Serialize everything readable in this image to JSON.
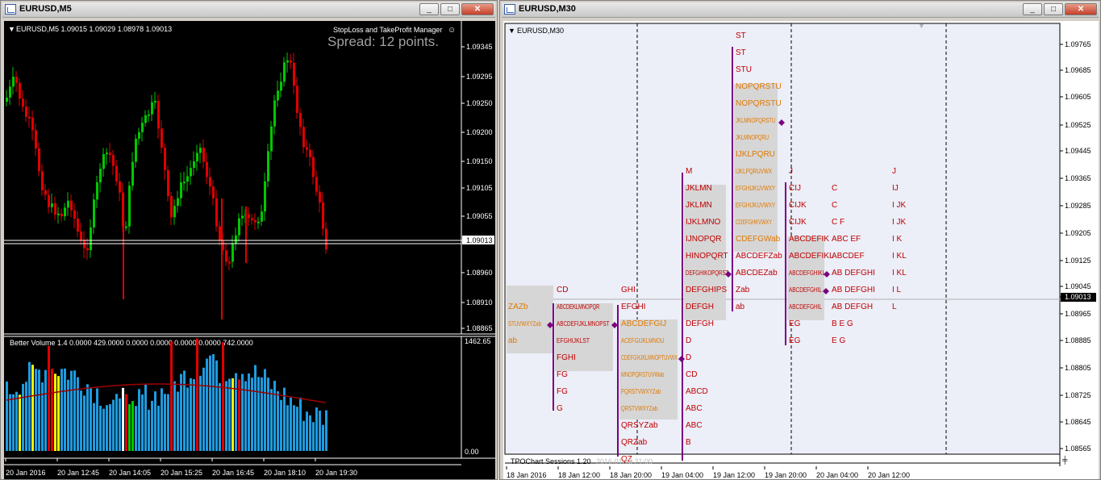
{
  "left_window": {
    "title": "EURUSD,M5",
    "buttons": {
      "minimize": "_",
      "maximize": "□",
      "close": "✕"
    },
    "price_header": "EURUSD,M5  1.09015 1.09029 1.08978 1.09013",
    "sltp_label": "StopLoss and TakeProfit Manager",
    "spread_text": "Spread: 12 points.",
    "price_axis": [
      "1.09345",
      "1.09295",
      "1.09250",
      "1.09200",
      "1.09150",
      "1.09105",
      "1.09055",
      "1.09013",
      "1.08960",
      "1.08910",
      "1.08865"
    ],
    "current_price": "1.09013",
    "volume_header": "Better Volume 1.4 0.0000 429.0000 0.0000 0.0000 0.0000 0.0000 742.0000",
    "volume_axis_top": "1462.65",
    "volume_axis_bottom": "0.00",
    "time_axis": [
      "20 Jan 2016",
      "20 Jan 12:45",
      "20 Jan 14:05",
      "20 Jan 15:25",
      "20 Jan 16:45",
      "20 Jan 18:10",
      "20 Jan 19:30"
    ],
    "colors": {
      "bull": "#00c800",
      "bear": "#e00000",
      "climax": "#ffff00",
      "volume": "#1e9be0",
      "ma": "#a00000"
    }
  },
  "right_window": {
    "title": "EURUSD,M30",
    "buttons": {
      "minimize": "_",
      "maximize": "□",
      "close": "✕"
    },
    "chart_label": "EURUSD,M30",
    "price_axis": [
      "1.09765",
      "1.09685",
      "1.09605",
      "1.09525",
      "1.09445",
      "1.09365",
      "1.09285",
      "1.09205",
      "1.09125",
      "1.09045",
      "1.09013",
      "1.08965",
      "1.08885",
      "1.08805",
      "1.08725",
      "1.08645",
      "1.08565"
    ],
    "current_price": "1.09013",
    "indicator_label": "TPOChart Sessions 1.20",
    "indicator_faint": "2016.01.18 21:00",
    "time_axis": [
      "18 Jan 2016",
      "18 Jan 12:00",
      "18 Jan 20:00",
      "19 Jan 04:00",
      "19 Jan 12:00",
      "19 Jan 20:00",
      "20 Jan 04:00",
      "20 Jan 12:00"
    ],
    "colors": {
      "tpo_red": "#c00000",
      "tpo_orange": "#e07800",
      "va_box": "#d6d6d6",
      "poc": "#7a0080",
      "bg": "#eceef8"
    },
    "sessions": [
      {
        "name": "s1",
        "rows": [
          "ZAZb",
          "STUVWXYZab",
          "ab"
        ]
      },
      {
        "name": "s2",
        "rows": [
          "CD",
          "ABCDEKLMNOPQR",
          "ABCDEFIJKLMNOPST",
          "EFGHIJKLST",
          "FGHI",
          "FG",
          "FG",
          "G"
        ]
      },
      {
        "name": "s3",
        "rows": [
          "GHI",
          "EFGHI",
          "ABCDEFGIJ",
          "ACEFGIJKLMNOU",
          "CDEFGHJKLMNOPTUVWX",
          "MNOPQRSTUVWab",
          "PQRSTVWXYZab",
          "QRSTVWXYZab",
          "QRSYZab",
          "QRZab",
          "QZ"
        ]
      },
      {
        "name": "s4",
        "rows": [
          "M",
          "JKLMN",
          "JKLMN",
          "IJKLMNO",
          "IJNOPQR",
          "HINOPQRT",
          "DEFGHIKOPQRST",
          "DEFGHIPS",
          "DEFGH",
          "DEFGH",
          "D",
          "D",
          "CD",
          "ABCD",
          "ABC",
          "ABC",
          "B"
        ]
      },
      {
        "name": "s5",
        "rows": [
          "ST",
          "ST",
          "STU",
          "NOPQRSTU",
          "NOPQRSTU",
          "JKLMNOPQRSTU",
          "JKLMNOPQRU",
          "IJKLPQRU",
          "IJKLPQRUVWX",
          "EFGHIJKUVWXY",
          "EFGHIJKUVWXY",
          "CDEFGHKVWXY",
          "CDEFGWab",
          "ABCDEFZab",
          "ABCDEZab",
          "Zab",
          "ab"
        ]
      },
      {
        "name": "s6",
        "rows": [
          "J",
          "CIJ",
          "CIJK",
          "CIJK",
          "ABCDEFIK",
          "ABCDEFIKL",
          "ABCDEFGHIKL",
          "ABCDEFGHIL",
          "ABCDEFGHIL",
          "EG",
          "EG"
        ]
      },
      {
        "name": "s7",
        "rows": [
          "",
          "C",
          "C",
          "C  F",
          "ABC EF",
          "ABCDEF",
          "AB DEFGHI",
          "AB DEFGHI",
          "AB DEFGH",
          "B  E G",
          "E G"
        ]
      },
      {
        "name": "s8",
        "rows": [
          "J",
          "IJ",
          "I JK",
          "I JK",
          "I  K",
          "I  KL",
          "I  KL",
          "I  L",
          "L"
        ]
      }
    ]
  }
}
